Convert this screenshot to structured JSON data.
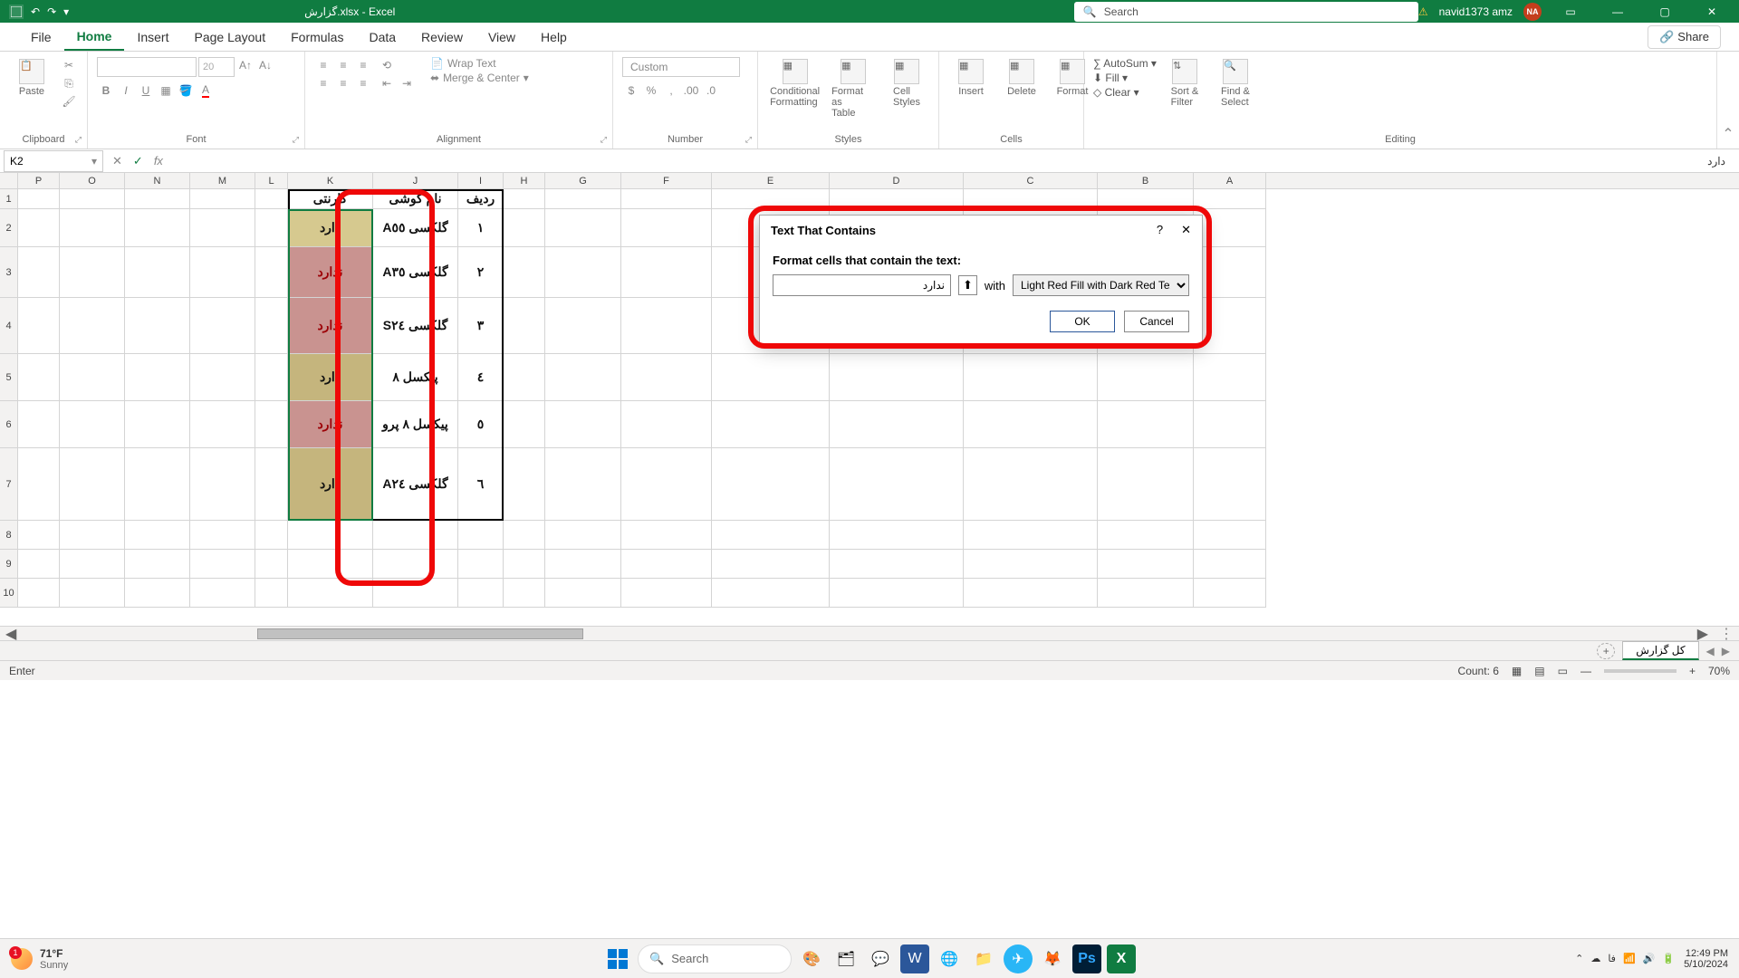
{
  "titlebar": {
    "filename": "گزارش.xlsx - Excel",
    "search_placeholder": "Search",
    "user_name": "navid1373 amz",
    "user_initials": "NA"
  },
  "tabs": {
    "file": "File",
    "home": "Home",
    "insert": "Insert",
    "page_layout": "Page Layout",
    "formulas": "Formulas",
    "data": "Data",
    "review": "Review",
    "view": "View",
    "help": "Help",
    "share": "Share"
  },
  "ribbon": {
    "clipboard": {
      "paste": "Paste",
      "label": "Clipboard"
    },
    "font": {
      "size": "20",
      "label": "Font"
    },
    "alignment": {
      "wrap": "Wrap Text",
      "merge": "Merge & Center",
      "label": "Alignment"
    },
    "number": {
      "format": "Custom",
      "label": "Number"
    },
    "styles": {
      "conditional": "Conditional\nFormatting",
      "format_table": "Format as\nTable",
      "cell_styles": "Cell\nStyles",
      "label": "Styles"
    },
    "cells": {
      "insert": "Insert",
      "delete": "Delete",
      "format": "Format",
      "label": "Cells"
    },
    "editing": {
      "autosum": "AutoSum",
      "fill": "Fill",
      "clear": "Clear",
      "sort": "Sort &\nFilter",
      "find": "Find &\nSelect",
      "label": "Editing"
    }
  },
  "formula_bar": {
    "name_box": "K2",
    "formula": "دارد"
  },
  "columns": [
    "P",
    "O",
    "N",
    "M",
    "L",
    "K",
    "J",
    "I",
    "H",
    "G",
    "F",
    "E",
    "D",
    "C",
    "B",
    "A"
  ],
  "grid": {
    "headers": {
      "warranty": "گارنتی",
      "phone": "نام گوشی",
      "row": "ردیف"
    },
    "rows": [
      {
        "n": "١",
        "phone": "گلکسی A٥٥",
        "warranty": "دارد",
        "fill": "light-yellow"
      },
      {
        "n": "٢",
        "phone": "گلکسی A٣٥",
        "warranty": "ندارد",
        "fill": "red-fill"
      },
      {
        "n": "٣",
        "phone": "گلکسی S٢٤",
        "warranty": "ندارد",
        "fill": "red-fill"
      },
      {
        "n": "٤",
        "phone": "پیکسل ۸",
        "warranty": "دارد",
        "fill": "yellow-fill"
      },
      {
        "n": "٥",
        "phone": "پیکسل ۸ پرو",
        "warranty": "ندارد",
        "fill": "red-fill"
      },
      {
        "n": "٦",
        "phone": "گلکسی A٢٤",
        "warranty": "دارد",
        "fill": "yellow-fill"
      }
    ]
  },
  "dialog": {
    "title": "Text That Contains",
    "subtitle": "Format cells that contain the text:",
    "input_value": "ندارد",
    "with": "with",
    "format_option": "Light Red Fill with Dark Red Text",
    "ok": "OK",
    "cancel": "Cancel"
  },
  "sheet_tabs": {
    "name": "کل گزارش"
  },
  "status": {
    "mode": "Enter",
    "count": "Count: 6",
    "zoom": "70%"
  },
  "taskbar": {
    "temp": "71°F",
    "condition": "Sunny",
    "search": "Search",
    "time": "12:49 PM",
    "date": "5/10/2024",
    "lang": "فا"
  }
}
